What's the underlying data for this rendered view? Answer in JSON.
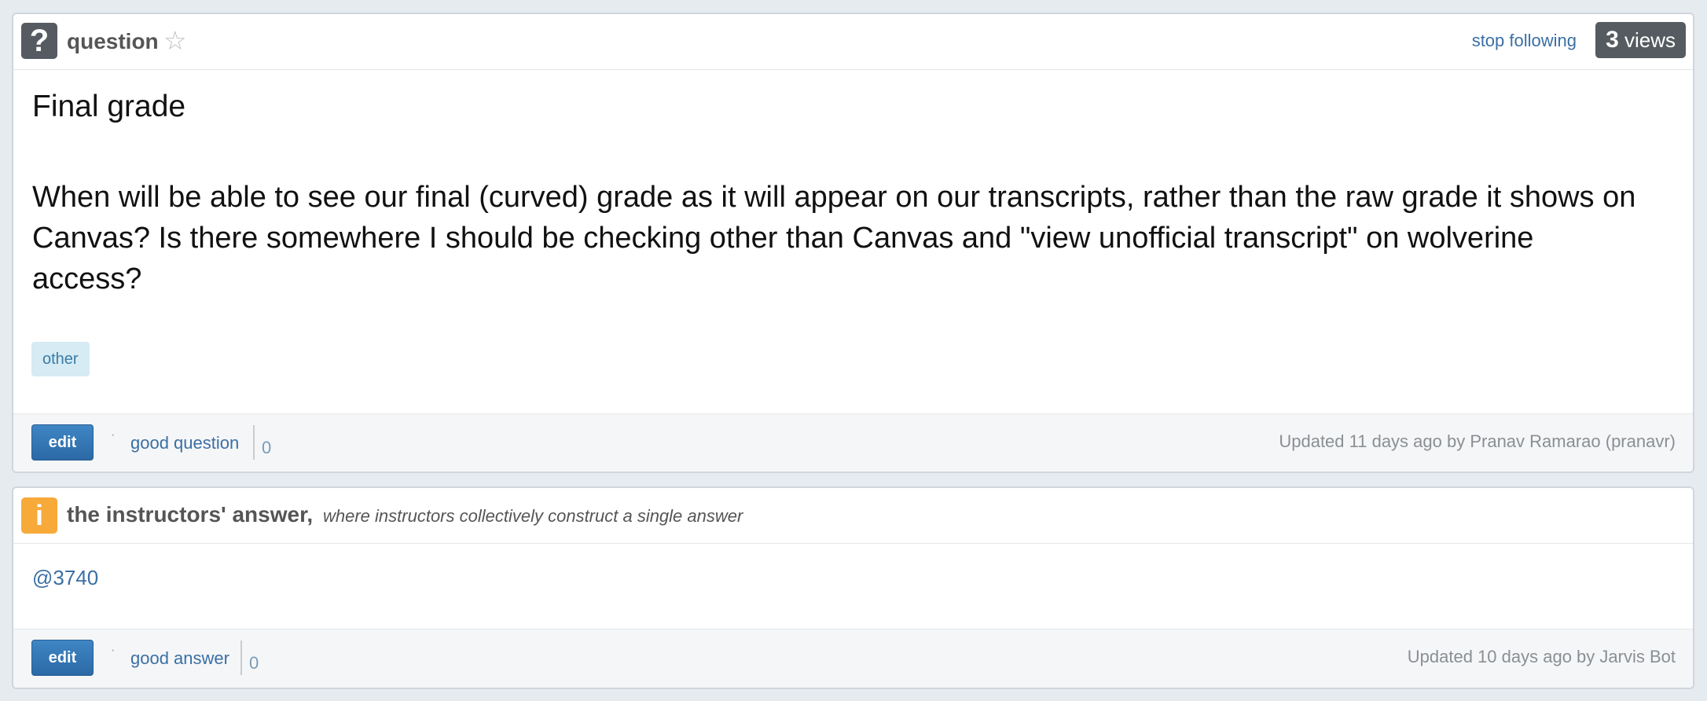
{
  "question": {
    "type_label": "question",
    "icon": "question-mark-icon",
    "stop_following": "stop following",
    "views_count": "3",
    "views_label": "views",
    "subject": "Final grade",
    "body": "When will be able to see our final (curved) grade as it will appear on our transcripts, rather than the raw grade it shows on Canvas? Is there somewhere I should be checking other than Canvas and \"view unofficial transcript\" on wolverine access?",
    "tag": "other",
    "edit_label": "edit",
    "good_label": "good question",
    "good_count": "0",
    "updated": "Updated 11 days ago by Pranav Ramarao (pranavr)"
  },
  "answer": {
    "icon": "info-icon",
    "title": "the instructors' answer,",
    "subtitle": "where instructors collectively construct a single answer",
    "body": "@3740",
    "edit_label": "edit",
    "good_label": "good answer",
    "good_count": "0",
    "updated": "Updated 10 days ago by Jarvis Bot"
  },
  "colors": {
    "link": "#3a6fa5",
    "edit_button": "#2b69a6",
    "info_icon": "#f7a93a",
    "question_icon": "#555b60"
  }
}
